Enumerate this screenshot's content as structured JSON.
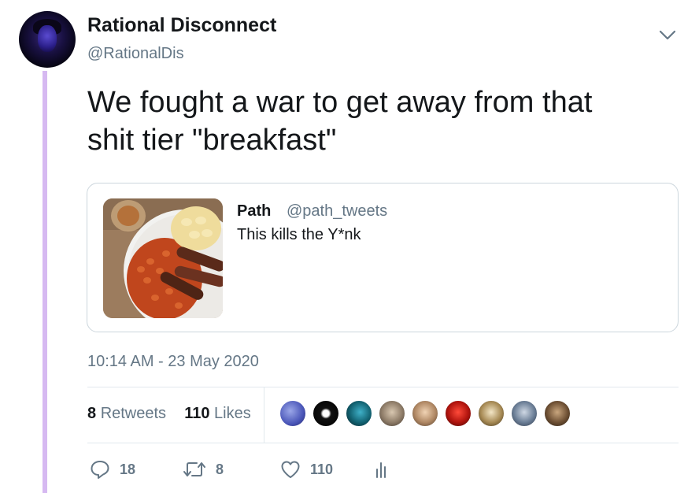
{
  "author": {
    "name": "Rational Disconnect",
    "handle": "@RationalDis"
  },
  "tweet": {
    "text_line1": "We fought a war to get away from that",
    "text_line2": "shit tier \"breakfast\""
  },
  "quoted_tweet": {
    "name": "Path",
    "handle": "@path_tweets",
    "text": "This kills the Y*nk"
  },
  "timestamp": "10:14 AM - 23 May 2020",
  "stats": {
    "retweets_count": "8",
    "retweets_label": "Retweets",
    "likes_count": "110",
    "likes_label": "Likes"
  },
  "actions": {
    "reply_count": "18",
    "retweet_count": "8",
    "like_count": "110"
  },
  "icons": [
    "chevron-down-icon",
    "reply-icon",
    "retweet-icon",
    "heart-icon",
    "analytics-icon"
  ],
  "colors": {
    "thread_line": "#d6b9f1",
    "secondary_text": "#657786",
    "primary_text": "#14171a",
    "border": "#e1e8ed"
  }
}
